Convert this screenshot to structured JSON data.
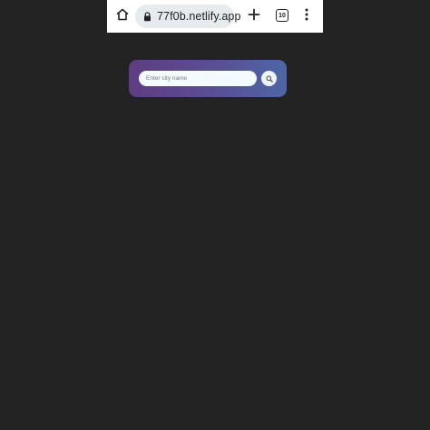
{
  "browser": {
    "url": "77f0b.netlify.app",
    "tab_count": "10",
    "icons": {
      "home": "home-icon",
      "lock": "lock-icon",
      "new_tab": "plus-icon",
      "menu": "more-vert-icon"
    }
  },
  "search": {
    "placeholder": "Enter city name",
    "value": "",
    "button_icon": "search-icon"
  },
  "colors": {
    "page_background": "#232323",
    "card_gradient_start": "#5f3d82",
    "card_gradient_end": "#4d66a6",
    "input_background": "#f3fbff"
  }
}
